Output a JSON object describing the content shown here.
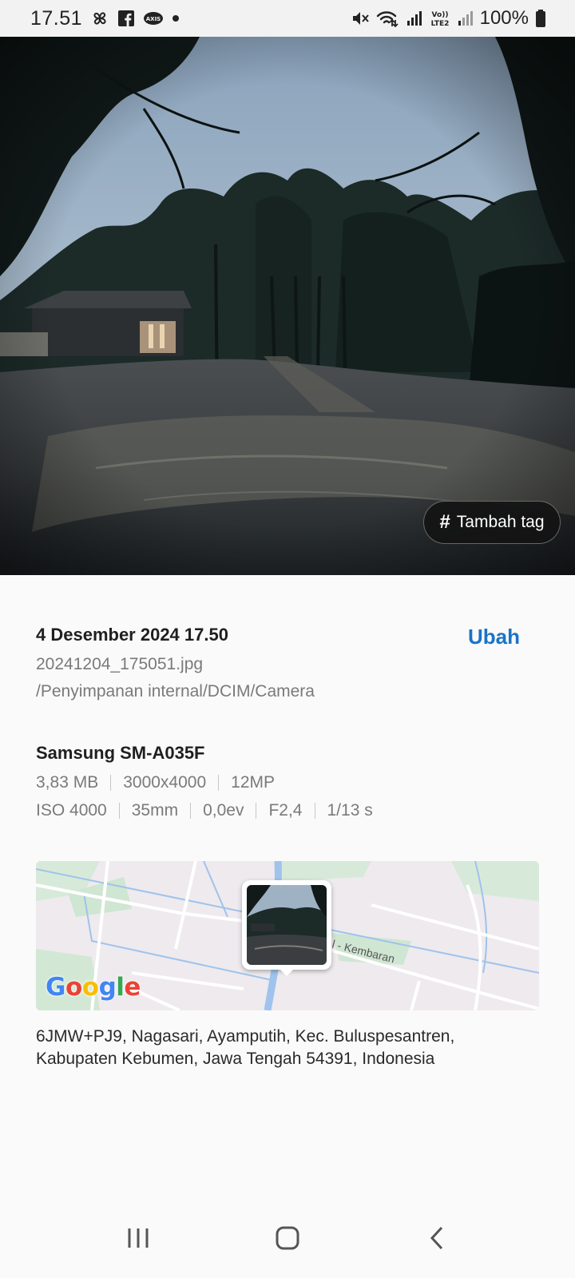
{
  "status_bar": {
    "time": "17.51",
    "battery": "100%",
    "left_icons": [
      "fan-icon",
      "facebook-icon",
      "axis-icon",
      "dot-icon"
    ],
    "right_icons": [
      "mute-icon",
      "wifi-icon",
      "signal-icon",
      "volte-lte2-icon",
      "signal-icon",
      "battery-icon"
    ],
    "volte_label": "Vo)) LTE2"
  },
  "photo": {
    "tag_button_label": "Tambah tag",
    "tag_button_icon": "hash-icon"
  },
  "details": {
    "date_time": "4 Desember 2024 17.50",
    "edit_label": "Ubah",
    "file_name": "20241204_175051.jpg",
    "file_path": "/Penyimpanan internal/DCIM/Camera",
    "device": "Samsung SM-A035F",
    "meta_row_1": [
      "3,83 MB",
      "3000x4000",
      "12MP"
    ],
    "meta_row_2": [
      "ISO 4000",
      "35mm",
      "0,0ev",
      "F2,4",
      "1/13 s"
    ]
  },
  "map": {
    "logo": "Google",
    "road_label": "l - Kembaran"
  },
  "address": "6JMW+PJ9, Nagasari, Ayamputih, Kec. Buluspesantren, Kabupaten Kebumen, Jawa Tengah 54391, Indonesia",
  "nav_bar": {
    "icons": [
      "recent-apps-icon",
      "home-icon",
      "back-icon"
    ]
  },
  "colors": {
    "accent": "#1a73c8",
    "secondary_text": "#7a7a7a",
    "background": "#fafafa"
  }
}
